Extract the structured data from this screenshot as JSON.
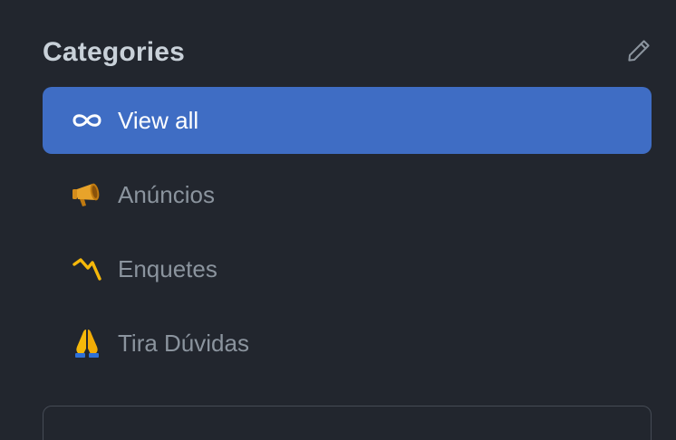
{
  "sidebar": {
    "title": "Categories",
    "edit_icon": "pencil-icon",
    "categories": [
      {
        "label": "View all",
        "icon": "infinity-icon",
        "active": true
      },
      {
        "label": "Anúncios",
        "icon": "megaphone-icon",
        "active": false
      },
      {
        "label": "Enquetes",
        "icon": "mountain-chart-icon",
        "active": false
      },
      {
        "label": "Tira Dúvidas",
        "icon": "folded-hands-icon",
        "active": false
      }
    ]
  },
  "colors": {
    "background": "#22262e",
    "active_item": "#3f6dc4",
    "title_text": "#c9d1d9",
    "muted_text": "#8b949e"
  }
}
